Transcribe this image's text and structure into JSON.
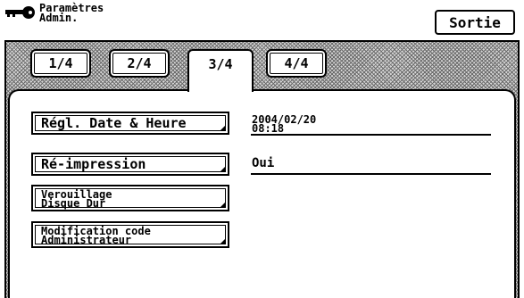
{
  "header": {
    "title_line1": "Paramètres",
    "title_line2": "Admin.",
    "title_icon": "key-icon",
    "exit_label": "Sortie"
  },
  "tabs": [
    {
      "label": "1/4",
      "active": false
    },
    {
      "label": "2/4",
      "active": false
    },
    {
      "label": "3/4",
      "active": true
    },
    {
      "label": "4/4",
      "active": false
    }
  ],
  "settings": [
    {
      "label": "Régl. Date & Heure",
      "value_line1": "2004/02/20",
      "value_line2": "08:18"
    },
    {
      "label": "Ré-impression",
      "value": "Oui"
    },
    {
      "label_line1": "Verouillage",
      "label_line2": "Disque Dur"
    },
    {
      "label_line1": "Modification code",
      "label_line2": "Administrateur"
    }
  ]
}
